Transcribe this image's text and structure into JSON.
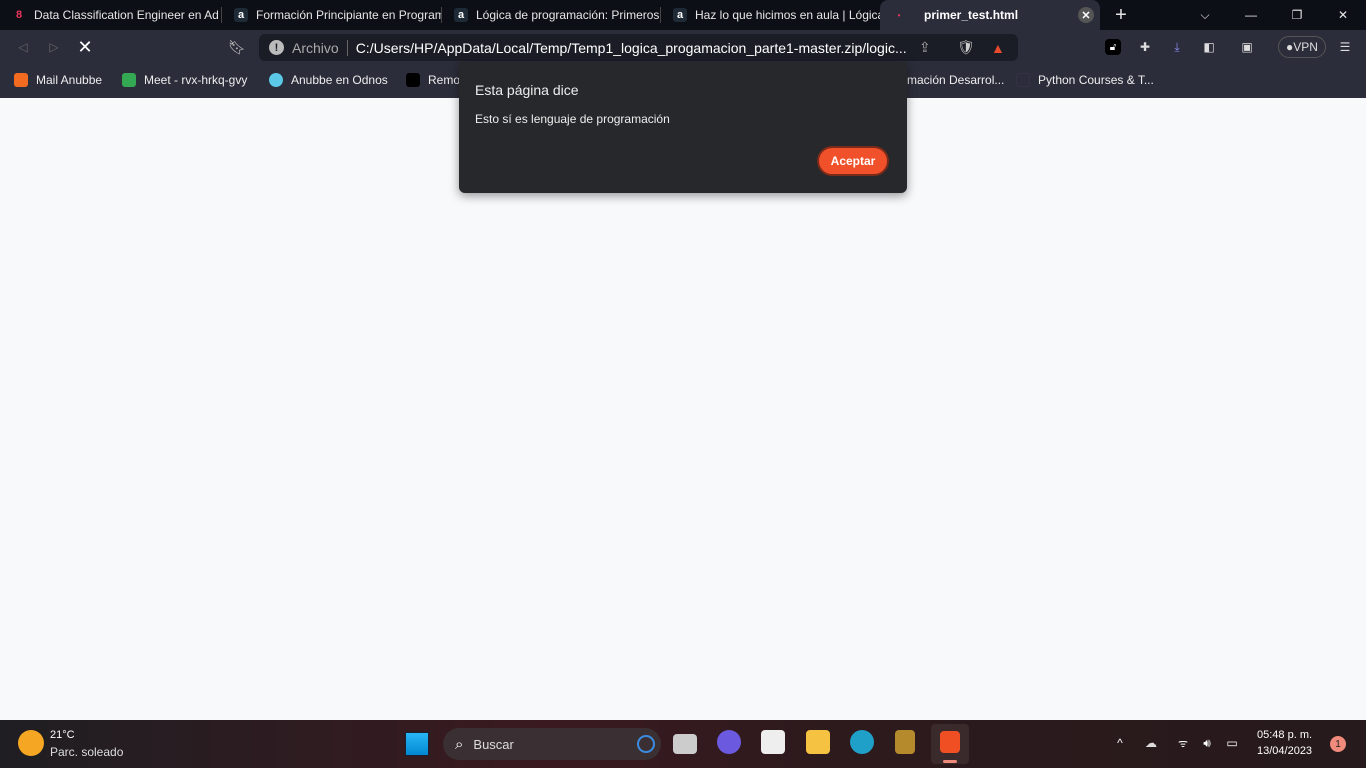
{
  "tabs": [
    {
      "label": "Data Classification Engineer en Ad",
      "icon": "anubbe-icon"
    },
    {
      "label": "Formación Principiante en Program",
      "icon": "alura-icon"
    },
    {
      "label": "Lógica de programación: Primeros",
      "icon": "alura-icon"
    },
    {
      "label": "Haz lo que hicimos en aula | Lógica",
      "icon": "alura-icon"
    },
    {
      "label": "primer_test.html",
      "icon": "file-icon",
      "active": true
    }
  ],
  "toolbar": {
    "scheme_label": "Archivo",
    "url": "C:/Users/HP/AppData/Local/Temp/Temp1_logica_progamacion_parte1-master.zip/logic...",
    "vpn_label": "VPN"
  },
  "bookmarks": [
    {
      "label": "Mail Anubbe"
    },
    {
      "label": "Meet - rvx-hrkq-gvy"
    },
    {
      "label": "Anubbe en Odnos"
    },
    {
      "label": "Remo"
    },
    {
      "label": "mación Desarrol..."
    },
    {
      "label": "Python Courses & T..."
    }
  ],
  "dialog": {
    "title": "Esta página dice",
    "message": "Esto sí es lenguaje de programación",
    "ok_label": "Aceptar",
    "accent": "#f0502a"
  },
  "taskbar": {
    "temp": "21°C",
    "weather": "Parc. soleado",
    "search_placeholder": "Buscar",
    "time": "05:48 p. m.",
    "date": "13/04/2023",
    "notifications": "1"
  }
}
